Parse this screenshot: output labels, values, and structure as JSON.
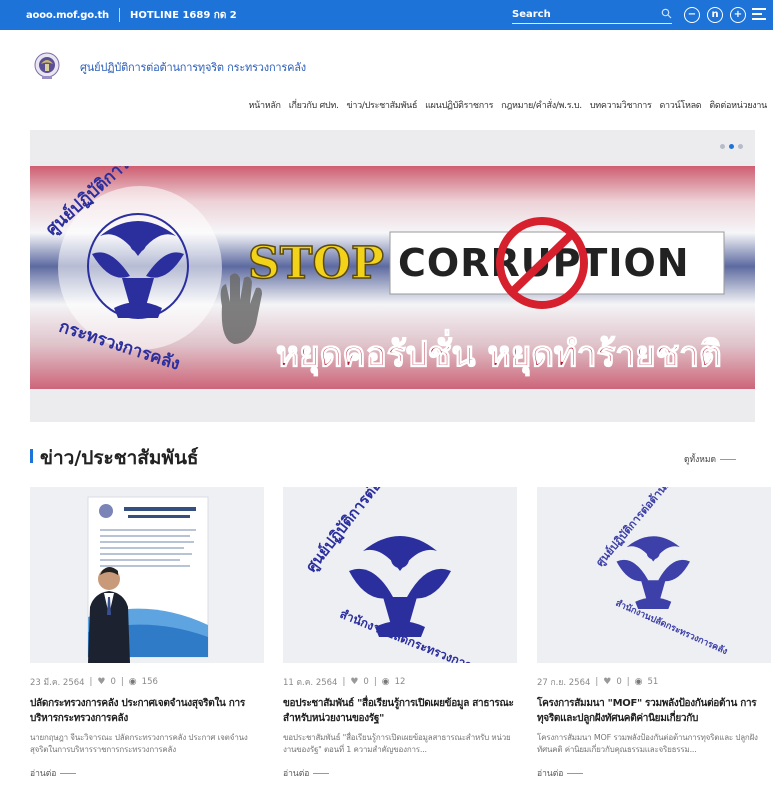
{
  "topbar": {
    "site": "aooo.mof.go.th",
    "hotline": "HOTLINE 1689 กด 2",
    "search_placeholder": "Search",
    "icons": [
      "search-icon",
      "zoom-out-icon",
      "reset-font-icon",
      "zoom-in-icon",
      "menu-icon"
    ],
    "zoom_out": "−",
    "reset_font": "n",
    "zoom_in": "+"
  },
  "header": {
    "org_title": "ศูนย์ปฏิบัติการต่อต้านการทุจริต กระทรวงการคลัง"
  },
  "nav": {
    "items": [
      "หน้าหลัก",
      "เกี่ยวกับ ศปท.",
      "ข่าว/ประชาสัมพันธ์",
      "แผนปฏิบัติราชการ",
      "กฎหมาย/คำสั่ง/พ.ร.บ.",
      "บทความวิชาการ",
      "ดาวน์โหลด",
      "ติดต่อหน่วยงาน"
    ]
  },
  "hero": {
    "slides": 3,
    "active_slide": 2,
    "banner_stop": "STOP",
    "banner_corruption": "CORRUPTION",
    "banner_slogan": "หยุดคอรัปชั่น หยุดทำร้ายชาติ",
    "seal_top": "ศูนย์ปฏิบัติการต่อต้านการทุจริต",
    "seal_bottom": "กระทรวงการคลัง"
  },
  "news": {
    "title": "ข่าว/ประชาสัมพันธ์",
    "see_all": "ดูทั้งหมด",
    "cards": [
      {
        "date": "23 มี.ค. 2564",
        "likes": "0",
        "views": "156",
        "title": "ปลัดกระทรวงการคลัง ประกาศเจตจำนงสุจริตใน การบริหารกระทรวงการคลัง",
        "excerpt": "นายกฤษฎา จีนะวิจารณะ ปลัดกระทรวงการคลัง ประกาศ เจตจำนงสุจริตในการบริหารราชการกระทรวงการคลัง",
        "read_more": "อ่านต่อ"
      },
      {
        "date": "11 ต.ค. 2564",
        "likes": "0",
        "views": "12",
        "title": "ขอประชาสัมพันธ์ \"สื่อเรียนรู้การเปิดเผยข้อมูล สาธารณะสำหรับหน่วยงานของรัฐ\"",
        "excerpt": "ขอประชาสัมพันธ์ \"สื่อเรียนรู้การเปิดเผยข้อมูลสาธารณะสำหรับ หน่วยงานของรัฐ\" ตอนที่ 1 ความสำคัญของการ...",
        "read_more": "อ่านต่อ",
        "seal_top": "ศูนย์ปฏิบัติการต่อต้านการทุจริต",
        "seal_bottom": "สำนักงานปลัดกระทรวงการคลัง"
      },
      {
        "date": "27 ก.ย. 2564",
        "likes": "0",
        "views": "51",
        "title": "โครงการสัมมนา \"MOF\" รวมพลังป้องกันต่อต้าน การทุจริตและปลูกฝังทัศนคติค่านิยมเกี่ยวกับ",
        "excerpt": "โครงการสัมมนา MOF รวมพลังป้องกันต่อต้านการทุจริตและ ปลูกฝังทัศนคติ ค่านิยมเกี่ยวกับคุณธรรมและจริยธรรม...",
        "read_more": "อ่านต่อ",
        "seal_top": "ศูนย์ปฏิบัติการต่อต้านการทุจริต",
        "seal_bottom": "สำนักงานปลัดกระทรวงการคลัง"
      }
    ]
  },
  "colors": {
    "primary": "#1e73d8",
    "seal_blue": "#2b2f9e",
    "slogan_red": "#b3122a",
    "stop_yellow": "#f3d21a"
  }
}
